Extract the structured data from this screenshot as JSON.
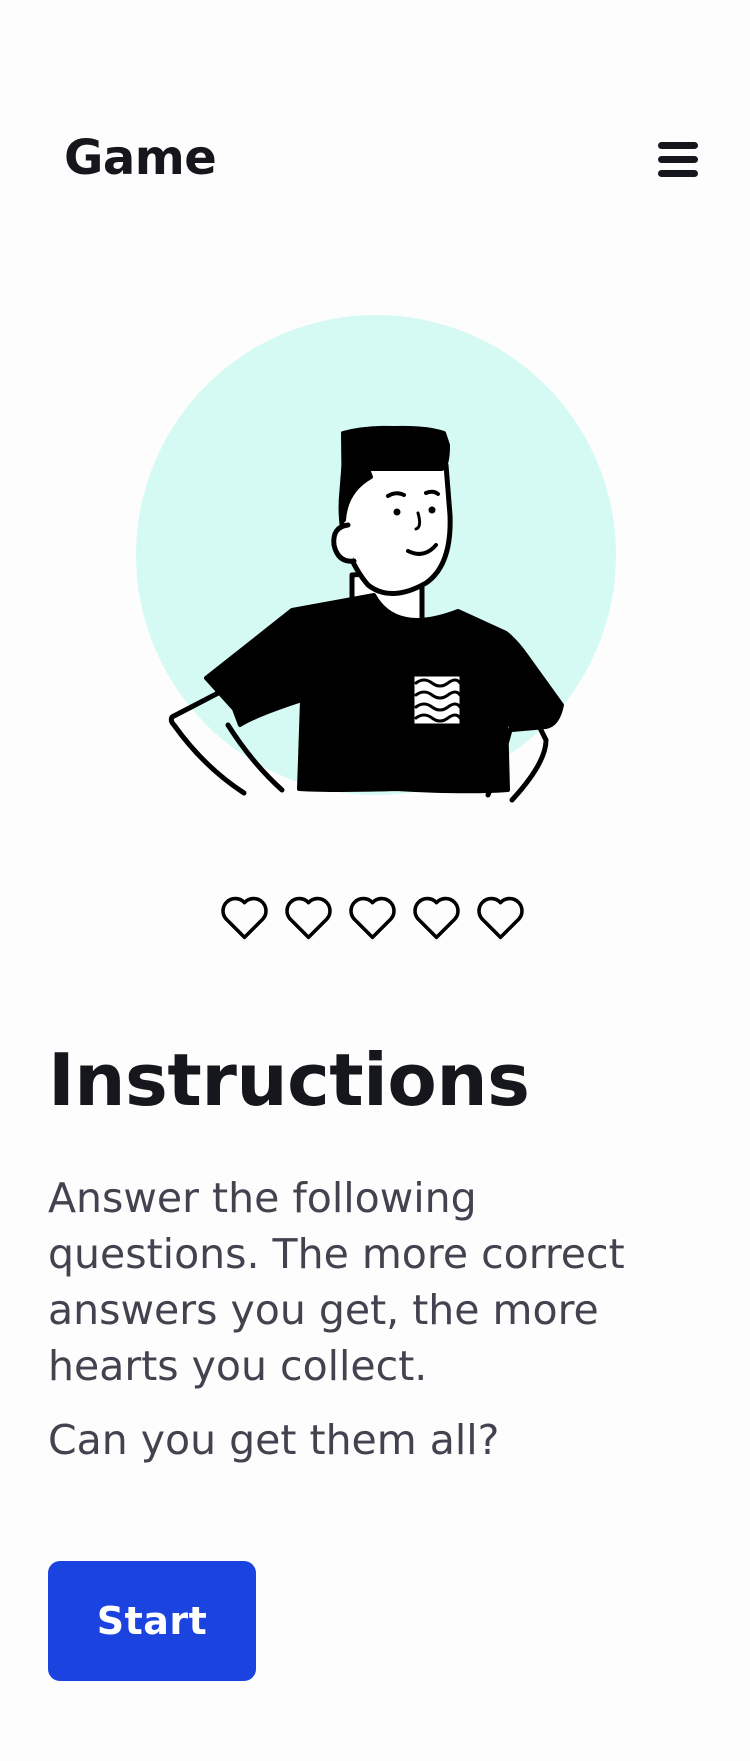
{
  "header": {
    "brand": "Game",
    "menu_icon": "hamburger-menu-icon"
  },
  "hero": {
    "illustration": "person-in-t-shirt-illustration",
    "circle_color": "#d5faf4"
  },
  "hearts": {
    "icon": "heart-outline-icon",
    "filled": 0,
    "total": 5
  },
  "main": {
    "title": "Instructions",
    "description": "Answer the following questions. The more correct answers you get, the more hearts you collect.",
    "prompt": "Can you get them all?"
  },
  "actions": {
    "start_label": "Start",
    "start_color": "#1a43e0"
  }
}
